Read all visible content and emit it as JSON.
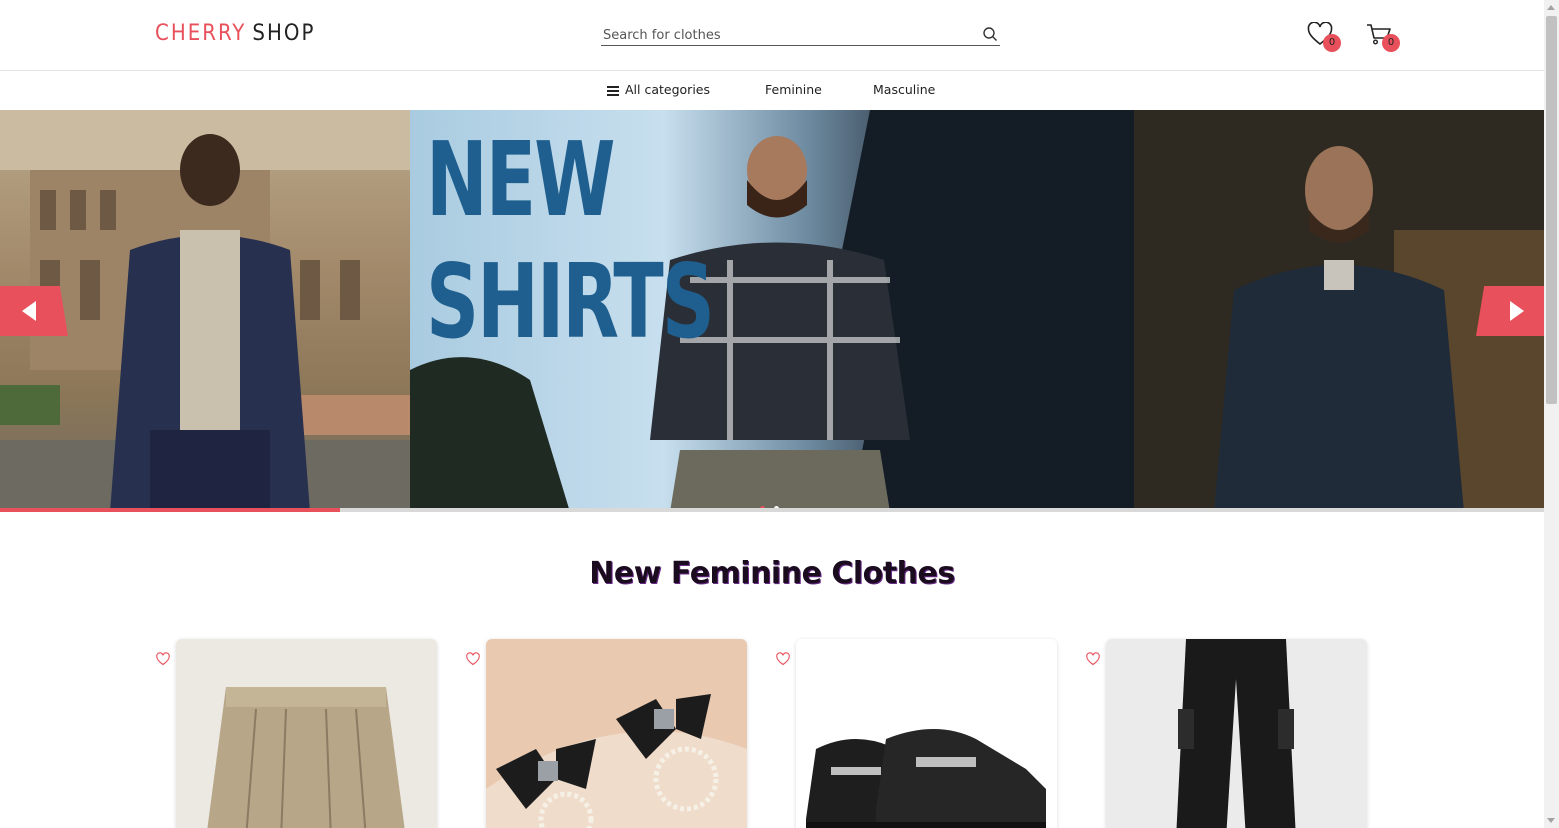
{
  "header": {
    "logo_part1": "CHERRY",
    "logo_part2": "SHOP",
    "search_placeholder": "Search for clothes",
    "wishlist_count": "0",
    "cart_count": "0"
  },
  "nav": {
    "items": [
      {
        "label": "All categories",
        "icon": "hamburger-menu-icon"
      },
      {
        "label": "Feminine"
      },
      {
        "label": "Masculine"
      }
    ]
  },
  "hero": {
    "title_line1": "NEW",
    "title_line2": "SHIRTS",
    "slide_count": 2,
    "active_slide": 1,
    "progress_fraction": 0.22
  },
  "section": {
    "title": "New Feminine Clothes"
  },
  "products": [
    {
      "name": "pleated skirt",
      "icon": "heart-icon"
    },
    {
      "name": "bow pearl earrings",
      "icon": "heart-icon"
    },
    {
      "name": "chain loafers",
      "icon": "heart-icon"
    },
    {
      "name": "cargo pants",
      "icon": "heart-icon"
    }
  ],
  "colors": {
    "accent": "#e8505b",
    "hero_title": "#1f5f8f",
    "section_title": "#1a0b1f"
  }
}
